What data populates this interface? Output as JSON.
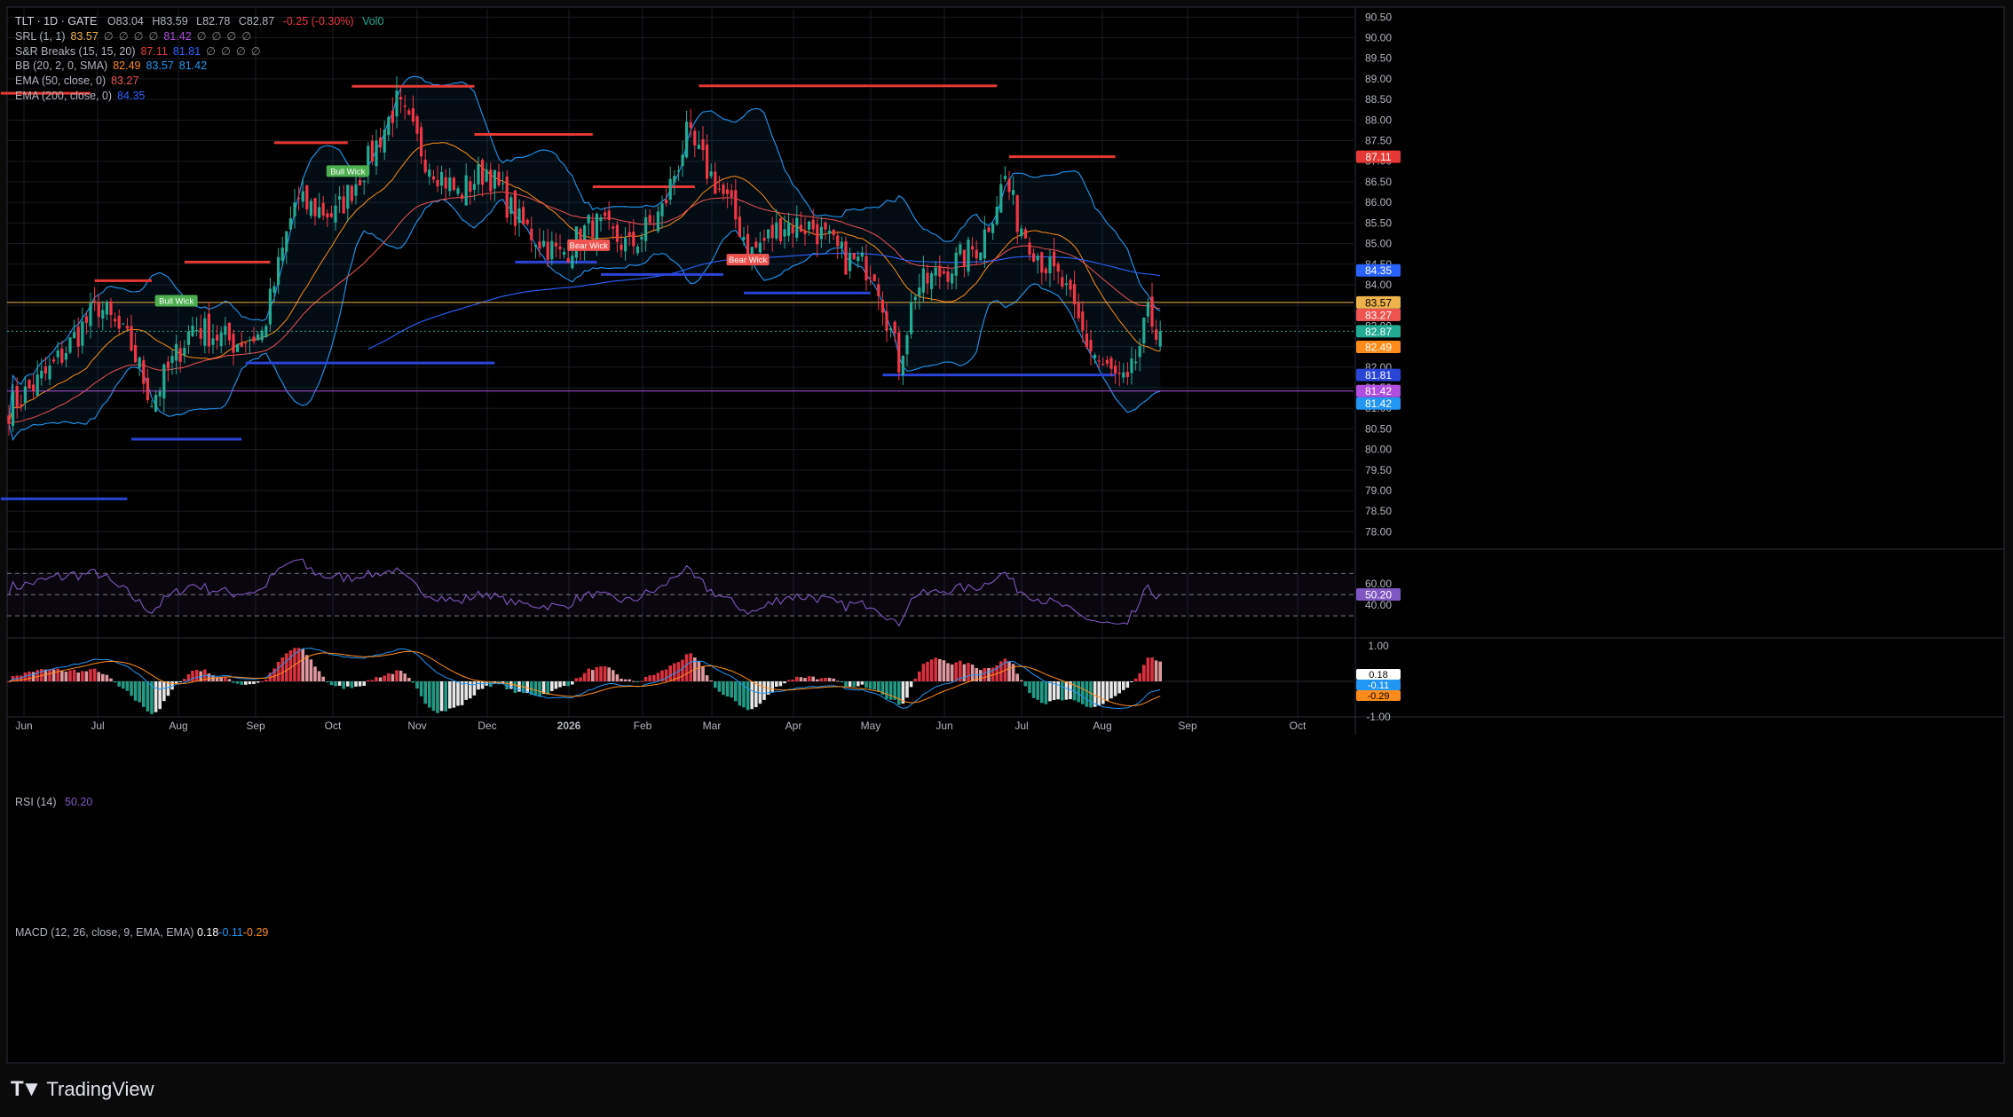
{
  "header": {
    "symbol": "TLT · 1D · GATE",
    "open": "O83.04",
    "high": "H83.59",
    "low": "L82.78",
    "close": "C82.87",
    "change": "-0.25 (-0.30%)",
    "volume": "Vol0",
    "indicators": [
      {
        "label": "SRL (1, 1)",
        "values": [
          "83.57",
          "∅",
          "∅",
          "∅",
          "∅",
          "81.42",
          "∅",
          "∅",
          "∅",
          "∅"
        ],
        "colors": [
          "#f0b24a",
          "#888888",
          "#888888",
          "#888888",
          "#888888",
          "#b14ee0",
          "#888888",
          "#888888",
          "#888888",
          "#888888"
        ]
      },
      {
        "label": "S&R Breaks (15, 15, 20)",
        "values": [
          "87.11",
          "81.81",
          "∅",
          "∅",
          "∅",
          "∅"
        ],
        "colors": [
          "#e53935",
          "#2962ff",
          "#888888",
          "#888888",
          "#888888",
          "#888888"
        ]
      },
      {
        "label": "BB (20, 2, 0, SMA)",
        "values": [
          "82.49",
          "83.57",
          "81.42"
        ],
        "colors": [
          "#ff8c1a",
          "#2196f3",
          "#2196f3"
        ]
      },
      {
        "label": "EMA (50, close, 0)",
        "values": [
          "83.27"
        ],
        "colors": [
          "#ef5350"
        ]
      },
      {
        "label": "EMA (200, close, 0)",
        "values": [
          "84.35"
        ],
        "colors": [
          "#2962ff"
        ]
      }
    ]
  },
  "rsi_legend": {
    "label": "RSI (14)",
    "value": "50.20"
  },
  "macd_legend": {
    "label": "MACD (12, 26, close, 9, EMA, EMA)",
    "values": [
      "0.18",
      "-0.11",
      "-0.29"
    ],
    "colors": [
      "#ffffff",
      "#2196f3",
      "#ff8c1a"
    ]
  },
  "brand": {
    "name": "TradingView"
  },
  "chart_data": {
    "type": "candlestick",
    "price_axis": {
      "ticks": [
        "90.50",
        "90.00",
        "89.50",
        "89.00",
        "88.50",
        "88.00",
        "87.50",
        "87.00",
        "86.50",
        "86.00",
        "85.50",
        "85.00",
        "84.50",
        "84.00",
        "83.50",
        "83.00",
        "82.50",
        "82.00",
        "81.50",
        "81.00",
        "80.50",
        "80.00",
        "79.50",
        "79.00",
        "78.50",
        "78.00"
      ],
      "ylim": [
        77.6,
        90.7
      ]
    },
    "time_axis": {
      "ticks": [
        "Jun",
        "Jul",
        "Aug",
        "Sep",
        "Oct",
        "Nov",
        "Dec",
        "2026",
        "Feb",
        "Mar",
        "Apr",
        "May",
        "Jun",
        "Jul",
        "Aug",
        "Sep",
        "Oct"
      ],
      "bold": "2026"
    },
    "price_anchors": [
      {
        "bar": 0,
        "close": 81.0
      },
      {
        "bar": 10,
        "close": 81.9
      },
      {
        "bar": 22,
        "close": 83.5
      },
      {
        "bar": 30,
        "close": 82.5
      },
      {
        "bar": 35,
        "close": 81.2
      },
      {
        "bar": 45,
        "close": 83.0
      },
      {
        "bar": 55,
        "close": 82.6
      },
      {
        "bar": 62,
        "close": 82.8
      },
      {
        "bar": 70,
        "close": 86.0
      },
      {
        "bar": 80,
        "close": 85.7
      },
      {
        "bar": 88,
        "close": 87.0
      },
      {
        "bar": 95,
        "close": 88.4
      },
      {
        "bar": 102,
        "close": 87.1
      },
      {
        "bar": 110,
        "close": 86.2
      },
      {
        "bar": 117,
        "close": 86.8
      },
      {
        "bar": 125,
        "close": 85.5
      },
      {
        "bar": 135,
        "close": 84.7
      },
      {
        "bar": 143,
        "close": 85.5
      },
      {
        "bar": 152,
        "close": 84.9
      },
      {
        "bar": 160,
        "close": 85.8
      },
      {
        "bar": 166,
        "close": 87.6
      },
      {
        "bar": 171,
        "close": 86.8
      },
      {
        "bar": 176,
        "close": 86.0
      },
      {
        "bar": 182,
        "close": 84.8
      },
      {
        "bar": 190,
        "close": 85.5
      },
      {
        "bar": 197,
        "close": 85.4
      },
      {
        "bar": 205,
        "close": 84.6
      },
      {
        "bar": 212,
        "close": 84.4
      },
      {
        "bar": 218,
        "close": 82.1
      },
      {
        "bar": 222,
        "close": 83.9
      },
      {
        "bar": 230,
        "close": 84.4
      },
      {
        "bar": 238,
        "close": 85.0
      },
      {
        "bar": 244,
        "close": 86.6
      },
      {
        "bar": 247,
        "close": 85.6
      },
      {
        "bar": 253,
        "close": 84.6
      },
      {
        "bar": 258,
        "close": 84.0
      },
      {
        "bar": 264,
        "close": 82.6
      },
      {
        "bar": 268,
        "close": 82.0
      },
      {
        "bar": 274,
        "close": 81.5
      },
      {
        "bar": 279,
        "close": 83.2
      },
      {
        "bar": 282,
        "close": 82.87
      }
    ],
    "current_price": 82.87,
    "price_labels": [
      {
        "value": 87.11,
        "text": "87.11",
        "color": "#e53935"
      },
      {
        "value": 84.35,
        "text": "84.35",
        "color": "#2962ff"
      },
      {
        "value": 83.57,
        "text": "83.57",
        "color": "#f0b24a",
        "text_color": "#000000"
      },
      {
        "value": 83.57,
        "text": "83.57",
        "color": "#2196f3",
        "offset": 1
      },
      {
        "value": 83.27,
        "text": "83.27",
        "color": "#ef5350"
      },
      {
        "value": 82.87,
        "text": "82.87",
        "color": "#22ab94"
      },
      {
        "value": 82.49,
        "text": "82.49",
        "color": "#ff8c1a"
      },
      {
        "value": 81.81,
        "text": "81.81",
        "color": "#2944d6"
      },
      {
        "value": 81.42,
        "text": "81.42",
        "color": "#b14ee0"
      },
      {
        "value": 81.42,
        "text": "81.42",
        "color": "#2196f3",
        "offset": 1
      }
    ],
    "resistance_levels": [
      {
        "from": -2,
        "to": 20,
        "value": 88.65
      },
      {
        "from": 21,
        "to": 35,
        "value": 84.1
      },
      {
        "from": 43,
        "to": 64,
        "value": 84.55
      },
      {
        "from": 65,
        "to": 83,
        "value": 87.45
      },
      {
        "from": 84,
        "to": 114,
        "value": 88.82
      },
      {
        "from": 114,
        "to": 143,
        "value": 87.65
      },
      {
        "from": 143,
        "to": 168,
        "value": 86.38
      },
      {
        "from": 169,
        "to": 242,
        "value": 88.83
      },
      {
        "from": 245,
        "to": 271,
        "value": 87.11
      }
    ],
    "support_levels": [
      {
        "from": -2,
        "to": 29,
        "value": 78.8
      },
      {
        "from": 30,
        "to": 57,
        "value": 80.25
      },
      {
        "from": 58,
        "to": 119,
        "value": 82.1
      },
      {
        "from": 124,
        "to": 144,
        "value": 84.55
      },
      {
        "from": 145,
        "to": 175,
        "value": 84.25
      },
      {
        "from": 180,
        "to": 211,
        "value": 83.8
      },
      {
        "from": 214,
        "to": 271,
        "value": 81.81
      }
    ],
    "horizontal_lines": [
      {
        "value": 83.57,
        "color": "#f0b24a"
      },
      {
        "value": 81.42,
        "color": "#b14ee0"
      }
    ],
    "wick_labels": [
      {
        "text": "Bull Wick",
        "bar": 41,
        "value": 83.6,
        "color": "#4caf50"
      },
      {
        "text": "Bull Wick",
        "bar": 83,
        "value": 86.75,
        "color": "#4caf50"
      },
      {
        "text": "Bear Wick",
        "bar": 142,
        "value": 84.95,
        "color": "#ef5350"
      },
      {
        "text": "Bear Wick",
        "bar": 181,
        "value": 84.6,
        "color": "#ef5350"
      }
    ],
    "ema_200_start_bar": 88,
    "rsi": {
      "label": "RSI (14)",
      "levels": [
        70,
        50,
        30
      ],
      "ticks": [
        "60.00",
        "40.00"
      ],
      "current": 50.2
    },
    "macd": {
      "ticks": [
        "1.00",
        "-1.00"
      ],
      "macd": 0.18,
      "signal": -0.11,
      "histogram": -0.29
    },
    "colors": {
      "up": "#22ab94",
      "down": "#f23645",
      "bb": "#2196f3",
      "bb_basis": "#ff8c1a",
      "ema50": "#ef5350",
      "ema200": "#2962ff",
      "rsi": "#7e57c2"
    }
  }
}
